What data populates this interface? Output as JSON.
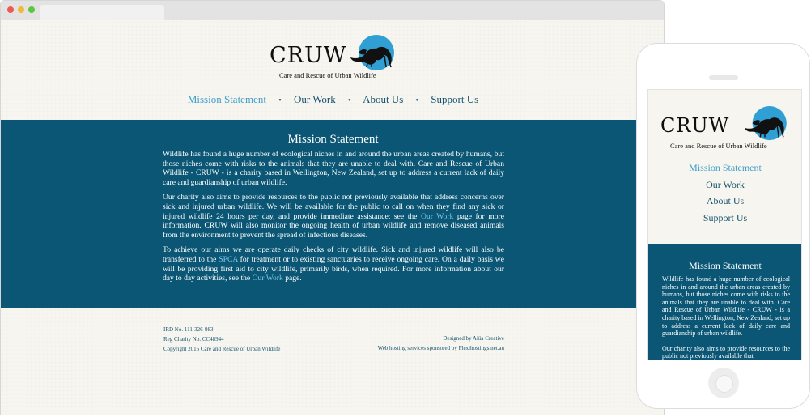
{
  "site": {
    "logo_text": "CRUW",
    "logo_subtitle": "Care and Rescue of Urban Wildlife"
  },
  "nav": {
    "items": [
      "Mission Statement",
      "Our Work",
      "About Us",
      "Support Us"
    ],
    "separator": "•",
    "active_index": 0
  },
  "mission": {
    "title": "Mission Statement",
    "p1": "Wildlife has found a huge number of ecological niches in and around the urban areas created by humans, but those niches come with risks to the animals that they are unable to deal with. Care and Rescue of Urban Wildlife - CRUW - is a charity based in Wellington, New Zealand, set up to address a current lack of daily care and guardianship of urban wildlife.",
    "p2_a": "Our charity also aims to provide resources to the public not previously available that address concerns over sick and injured urban wildlife. We will be available for the public to call on when they find any sick or injured wildlife 24 hours per day, and provide immediate assistance; see the ",
    "p2_link": "Our Work",
    "p2_b": " page for more information. CRUW will also monitor the ongoing health of urban wildlife and remove diseased animals from the environment to prevent the spread of infectious diseases.",
    "p3_a": "To achieve our aims we are operate daily checks of city wildlife. Sick and injured wildlife will also be transferred to the ",
    "p3_link1": "SPCA",
    "p3_b": " for treatment or to existing sanctuaries to receive ongoing care. On a daily basis we will be providing first aid to city wildlife, primarily birds, when required. For more information about our day to day activities, see the ",
    "p3_link2": "Our Work",
    "p3_c": " page."
  },
  "footer": {
    "ird": "IRD No. 111-326-983",
    "charity": "Reg Charity No. CC48944",
    "copyright": "Copyright 2016 Care and Rescue of Urban Wildlife",
    "designed": "Designed by Aiüa Creative",
    "hosting": "Web hosting services sponsored by Flexihostings.net.au"
  },
  "mobile": {
    "p1": "Wildlife has found a huge number of ecological niches in and around the urban areas created by humans, but those niches come with risks to the animals that they are unable to deal with. Care and Rescue of Urban Wildlife - CRUW - is a charity based in Wellington, New Zealand, set up to address a current lack of daily care and guardianship of urban wildlife.",
    "p2": "Our charity also aims to provide resources to the public not previously available that"
  },
  "colors": {
    "band": "#0a5674",
    "link": "#3f9fc8",
    "nav": "#17546f",
    "logo_circle": "#2f9fd4"
  },
  "icons": [
    "bird-logo-icon"
  ]
}
